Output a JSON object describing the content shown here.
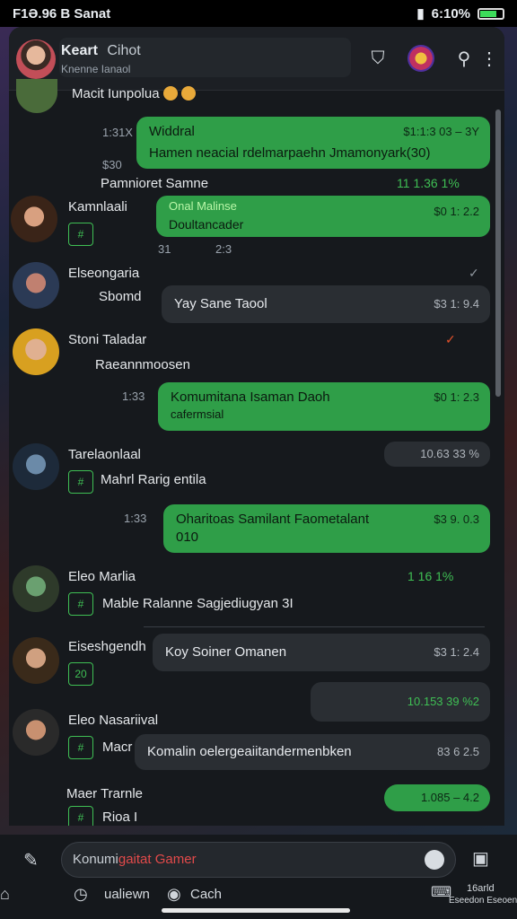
{
  "status_bar": {
    "left_text": "F1Ə.96 B Sanat",
    "battery_text": "6:10%"
  },
  "header": {
    "title": "Keart",
    "title_tag": "Cihot",
    "subtitle": "Knenne Ianaol",
    "icons": [
      "shield-icon",
      "game-avatar-icon",
      "search-icon",
      "more-icon"
    ]
  },
  "messages": [
    {
      "name": "Macit",
      "sub": "Iunpolua",
      "badge": "",
      "time_left": "1:31X",
      "bubble_type": "green",
      "line1": "Widdral",
      "line2": "Hamen neacial rdelmarpaehn Jmamonyark(30)",
      "meta": "$1:1:3 03 – 3Y",
      "below": "Pamnioret Samne",
      "below_meta": "11 1.36 1%"
    },
    {
      "name": "Kamnlaali",
      "badge": "#",
      "bubble_type": "green",
      "line1": "Onal Malinse",
      "line2": "Doultancader",
      "meta": "$0 1: 2.2",
      "below": "31",
      "below_meta": "2:3"
    },
    {
      "name": "Elseongaria",
      "sub": "Sbomd",
      "badge": "",
      "bubble_type": "dark",
      "line1": "Yay Sane Taool",
      "meta": "$3 1: 9.4"
    },
    {
      "name": "Stoni Taladar",
      "sub": "Raeannmoosen",
      "badge": "",
      "bubble_type": "green",
      "time_left": "1:33",
      "line1": "Komumitana Isaman Daoh",
      "line2": "cafermsial",
      "meta": "$0 1: 2.3"
    },
    {
      "name": "Tarelaonlaal",
      "sub": "Mahrl Rarig entila",
      "badge": "#",
      "bubble_type": "dark_meta",
      "meta": "10.63 33 %"
    },
    {
      "name": "",
      "bubble_type": "green",
      "time_left": "1:33",
      "line1": "Oharitoas Samilant Faometalant",
      "line2": "010",
      "meta": "$3 9. 0.3"
    },
    {
      "name": "Eleo Marlia",
      "sub": "Mable Ralanne Sagjediugyan 3I",
      "badge": "#",
      "meta": "1 16 1%"
    },
    {
      "name": "Eiseshgendh",
      "sub": "20",
      "badge": "#",
      "bubble_type": "dark",
      "line1": "Koy Soiner Omanen",
      "meta": "$3 1: 2.4"
    },
    {
      "name": "",
      "bubble_type": "dark",
      "meta": "10.153 39 %2"
    },
    {
      "name": "Eleo Nasariival",
      "sub": "Macr",
      "badge": "#",
      "bubble_type": "dark",
      "line1": "Komalin oelergeaiitandermenbken",
      "meta": "83 6 2.5"
    },
    {
      "name": "Maer Trarnle",
      "sub": "Rioa I",
      "badge": "#",
      "bubble_type": "green",
      "meta": "1.085 – 4.2"
    }
  ],
  "composer": {
    "placeholder_prefix": "Konumi",
    "placeholder_red": "gaitat Gamer"
  },
  "nav": {
    "item1": "ualiewn",
    "item2": "Cach",
    "item3_line1": "16arld",
    "item3_line2": "Eseedon Eseoen"
  }
}
